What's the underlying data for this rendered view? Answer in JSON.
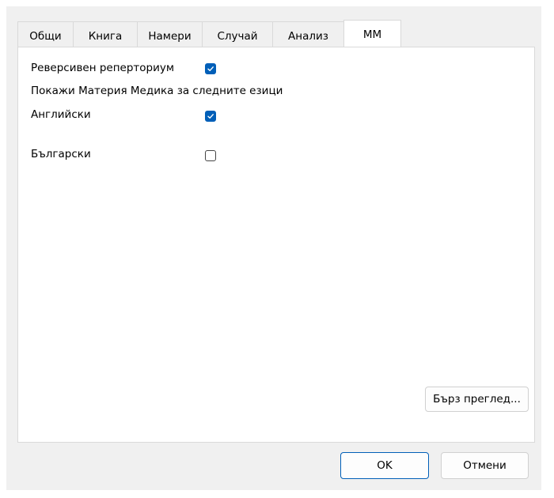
{
  "tabs": [
    {
      "label": "Общи"
    },
    {
      "label": "Книга"
    },
    {
      "label": "Намери"
    },
    {
      "label": "Случай"
    },
    {
      "label": "Анализ"
    },
    {
      "label": "ММ",
      "active": true
    }
  ],
  "mm": {
    "reverse_repertory_label": "Реверсивен реперториум",
    "reverse_repertory_checked": true,
    "languages_heading": "Покажи Материя Медика за следните езици",
    "languages": [
      {
        "label": "Английски",
        "checked": true
      },
      {
        "label": "Български",
        "checked": false
      }
    ],
    "quick_view_label": "Бърз преглед..."
  },
  "footer": {
    "ok_label": "OK",
    "cancel_label": "Отмени"
  },
  "colors": {
    "accent": "#005fb8",
    "dialog_bg": "#f0f0f0",
    "panel_bg": "#ffffff"
  }
}
